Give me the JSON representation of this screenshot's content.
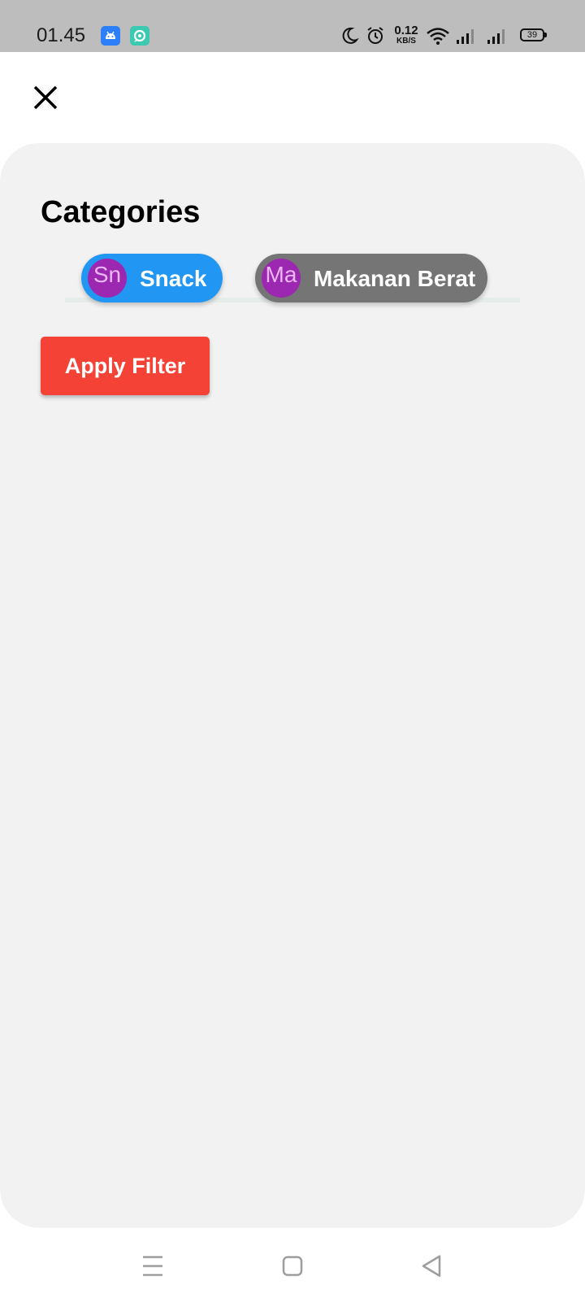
{
  "status_bar": {
    "time": "01.45",
    "app_icons": [
      "android-icon",
      "chat-app-icon"
    ],
    "net_speed_value": "0.12",
    "net_speed_unit": "KB/S",
    "battery_level": "39",
    "icons": [
      "moon-icon",
      "alarm-icon",
      "wifi-icon",
      "signal-icon",
      "signal-icon",
      "battery-icon"
    ]
  },
  "header": {
    "close_icon": "close-icon"
  },
  "filter": {
    "heading": "Categories",
    "chips": [
      {
        "avatar": "Sn",
        "label": "Snack",
        "selected": true,
        "color": "#2196f3"
      },
      {
        "avatar": "Ma",
        "label": "Makanan Berat",
        "selected": false,
        "color": "#757575"
      }
    ],
    "avatar_color": "#9c27b0",
    "apply_label": "Apply Filter",
    "apply_color": "#f44336"
  },
  "nav_bar": {
    "buttons": [
      "menu-icon",
      "home-icon",
      "back-icon"
    ]
  }
}
